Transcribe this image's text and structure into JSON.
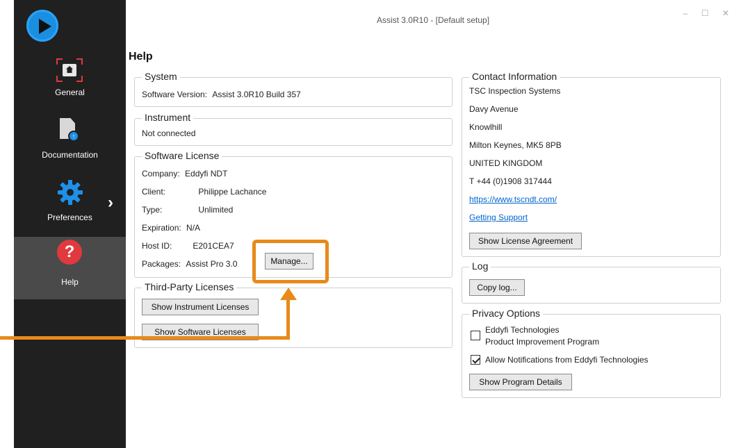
{
  "window": {
    "title": "Assist 3.0R10 - [Default setup]",
    "controls": [
      "–",
      "☐",
      "✕"
    ]
  },
  "sidebar": {
    "items": [
      {
        "label": "General",
        "icon": "home-icon"
      },
      {
        "label": "Documentation",
        "icon": "document-icon"
      },
      {
        "label": "Preferences",
        "icon": "gear-icon"
      },
      {
        "label": "Help",
        "icon": "help-icon",
        "active": true
      }
    ],
    "chevron": "›"
  },
  "page": {
    "title": "Help"
  },
  "system": {
    "title": "System",
    "label": "Software Version:",
    "value": "Assist 3.0R10 Build 357"
  },
  "instrument": {
    "title": "Instrument",
    "status": "Not connected"
  },
  "license": {
    "title": "Software License",
    "rows": [
      {
        "label": "Company:",
        "value": "Eddyfi NDT"
      },
      {
        "label": "Client:",
        "value": "Philippe Lachance"
      },
      {
        "label": "Type:",
        "value": "Unlimited"
      },
      {
        "label": "Expiration:",
        "value": "N/A"
      },
      {
        "label": "Host ID:",
        "value": "E201CEA7"
      },
      {
        "label": "Packages:",
        "value": "Assist Pro 3.0"
      }
    ],
    "manage_button": "Manage..."
  },
  "third_party": {
    "title": "Third-Party Licenses",
    "instrument_button": "Show Instrument Licenses",
    "software_button": "Show Software Licenses"
  },
  "contact": {
    "title": "Contact Information",
    "lines": [
      "TSC Inspection Systems",
      "Davy Avenue",
      "Knowlhill",
      "Milton Keynes, MK5 8PB",
      "UNITED KINGDOM",
      "T +44 (0)1908 317444"
    ],
    "website": "https://www.tscndt.com/",
    "support": "Getting Support",
    "agreement_button": "Show License Agreement"
  },
  "log": {
    "title": "Log",
    "copy_button": "Copy log..."
  },
  "privacy": {
    "title": "Privacy Options",
    "program_line1": "Eddyfi Technologies",
    "program_line2": "Product Improvement Program",
    "program_checked": false,
    "notifications_label": "Allow Notifications from Eddyfi Technologies",
    "notifications_checked": true,
    "details_button": "Show Program Details"
  },
  "colors": {
    "sidebar_bg": "#202020",
    "sidebar_active": "#4a4a4a",
    "accent_red": "#e0393e",
    "accent_blue": "#1a8fe0",
    "annotation_orange": "#e88a1a"
  }
}
